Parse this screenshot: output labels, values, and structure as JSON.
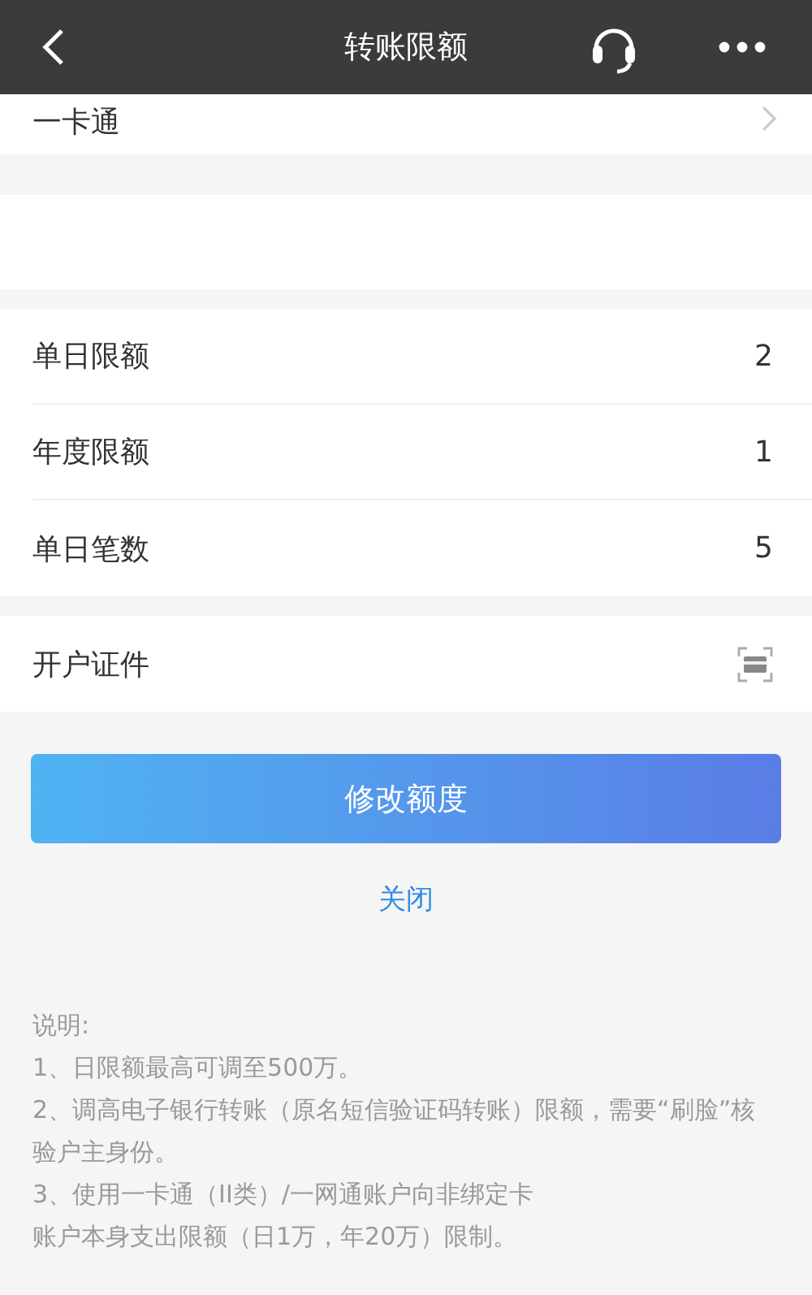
{
  "header": {
    "title": "转账限额"
  },
  "card_row": {
    "label": "一卡通"
  },
  "limits": [
    {
      "label": "单日限额",
      "value": "2"
    },
    {
      "label": "年度限额",
      "value": "1"
    },
    {
      "label": "单日笔数",
      "value": "5"
    }
  ],
  "id_row": {
    "label": "开户证件"
  },
  "primary_button": "修改额度",
  "close_link": "关闭",
  "notes": {
    "title": "说明:",
    "lines": [
      "1、日限额最高可调至500万。",
      "2、调高电子银行转账（原名短信验证码转账）限额，需要“刷脸”核验户主身份。",
      "3、使用一卡通（II类）/一网通账户向非绑定卡",
      "账户本身支出限额（日1万，年20万）限制。"
    ]
  }
}
